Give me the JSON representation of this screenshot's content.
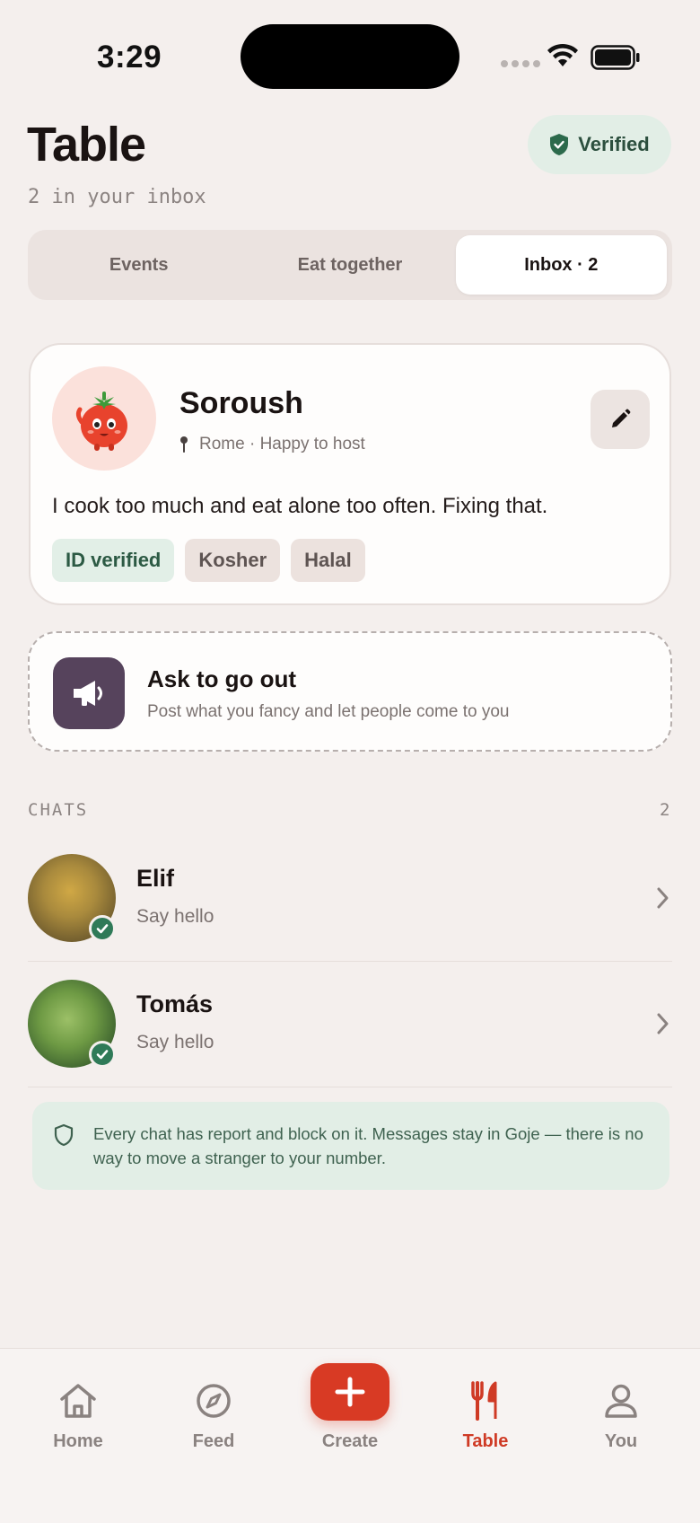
{
  "status_bar": {
    "time": "3:29"
  },
  "header": {
    "title": "Table",
    "subtitle": "2 in your inbox",
    "verified_label": "Verified"
  },
  "tabs": [
    {
      "label": "Events",
      "active": false
    },
    {
      "label": "Eat together",
      "active": false
    },
    {
      "label": "Inbox · 2",
      "active": true
    }
  ],
  "profile": {
    "name": "Soroush",
    "location": "Rome · Happy to host",
    "bio": "I cook too much and eat alone too often. Fixing that.",
    "tags": [
      "ID verified",
      "Kosher",
      "Halal"
    ]
  },
  "ask": {
    "title": "Ask to go out",
    "subtitle": "Post what you fancy and let people come to you"
  },
  "chats": {
    "label": "CHATS",
    "count": "2",
    "items": [
      {
        "name": "Elif",
        "message": "Say hello",
        "verified": true
      },
      {
        "name": "Tomás",
        "message": "Say hello",
        "verified": true
      }
    ]
  },
  "safety_note": "Every chat has report and block on it. Messages stay in Goje — there is no way to move a stranger to your number.",
  "bottom_nav": {
    "items": [
      {
        "label": "Home",
        "icon": "home-icon",
        "active": false
      },
      {
        "label": "Feed",
        "icon": "compass-icon",
        "active": false
      },
      {
        "label": "Create",
        "icon": "plus-icon",
        "active": false
      },
      {
        "label": "Table",
        "icon": "fork-knife-icon",
        "active": true
      },
      {
        "label": "You",
        "icon": "person-icon",
        "active": false
      }
    ]
  },
  "colors": {
    "background": "#f4efed",
    "accent": "#d83a24",
    "verified_green": "#2f7a58",
    "ask_icon_bg": "#56435c"
  }
}
